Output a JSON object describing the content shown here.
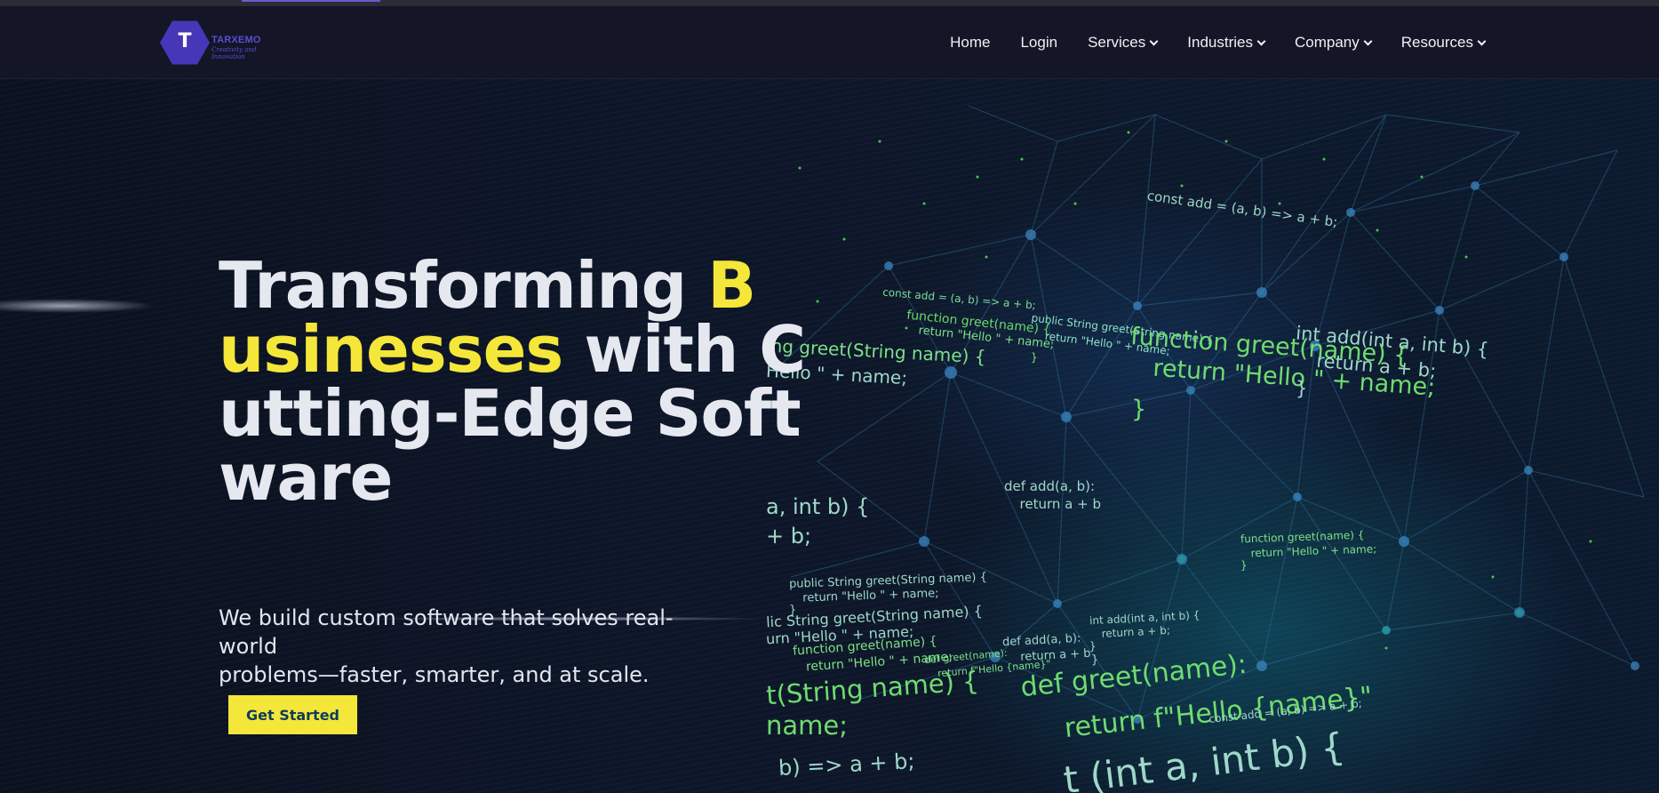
{
  "logo": {
    "brand": "TARXEMO",
    "tagline": "Creativity and Innovation"
  },
  "nav": {
    "items": [
      {
        "label": "Home",
        "dropdown": false
      },
      {
        "label": "Login",
        "dropdown": false
      },
      {
        "label": "Services",
        "dropdown": true
      },
      {
        "label": "Industries",
        "dropdown": true
      },
      {
        "label": "Company",
        "dropdown": true
      },
      {
        "label": "Resources",
        "dropdown": true
      }
    ]
  },
  "hero": {
    "headline": {
      "line1": "Transforming ",
      "line1_accent": "B",
      "line2_accent": "usinesses",
      "line2": " with C",
      "line3": "utting-Edge Soft",
      "line4": "ware"
    },
    "subtitle_line1": "We build custom software that solves real-world",
    "subtitle_line2": "problems—faster, smarter, and at scale.",
    "cta_label": "Get Started"
  },
  "code_snippets": [
    "const add = (a, b) => a + b;",
    "const add = (a, b) => a + b;",
    "function greet(name) {",
    "  return \"Hello \" + name;",
    "}",
    "public String greet(String name) {",
    "  return \"Hello \" + name;",
    "ing greet(String name) {",
    "Hello \" + name;",
    "function greet(name) {",
    "  return \"Hello \" + name;",
    "}",
    "int add(int a, int b) {",
    "  return a + b;",
    "}",
    "a, int b) {",
    "+ b;",
    "def add(a, b):",
    "  return a + b",
    "function greet(name) {",
    "  return \"Hello \" + name;",
    "}",
    "public String greet(String name) {",
    "  return \"Hello \" + name;",
    "}",
    "lic String greet(String name) {",
    "urn \"Hello \" + name;",
    "function greet(name) {",
    "  return \"Hello \" + name;",
    "def greet(name):",
    "  return f\"Hello {name}\"",
    "def add(a, b):",
    "  return a + b",
    "}",
    "int add(int a, int b) {",
    "  return a + b;",
    "}",
    "t(String name) {",
    "name;",
    "def greet(name):",
    "  return f\"Hello {name}\"",
    "const add = (a, b) => a + b;",
    "b) => a + b;",
    "t (int a, int b) {"
  ]
}
